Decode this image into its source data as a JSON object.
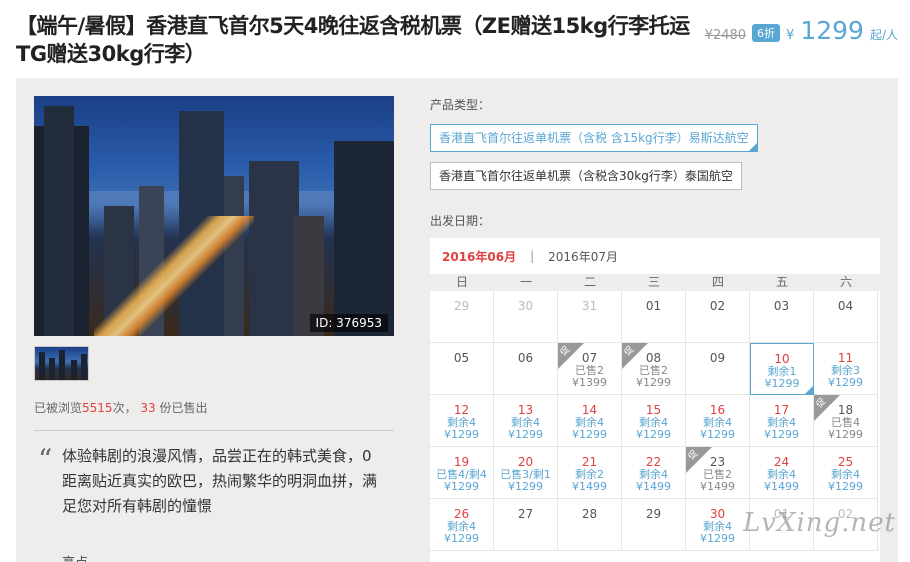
{
  "header": {
    "title": "【端午/暑假】香港直飞首尔5天4晚往返含税机票（ZE赠送15kg行李托运 TG赠送30kg行李）",
    "original_price": "¥2480",
    "discount": "6折",
    "currency": "¥",
    "price": "1299",
    "price_unit": "起/人"
  },
  "gallery": {
    "photo_id": "ID: 376953"
  },
  "stats": {
    "prefix": "已被浏览",
    "views": "5515",
    "mid": "次，",
    "sold": "33",
    "suffix": "份已售出"
  },
  "description": {
    "quote_mark": "“",
    "text": "体验韩剧的浪漫风情，品尝正在的韩式美食，0距离贴近真实的欧巴，热闹繁华的明洞血拼，满足您对所有韩剧的憧憬",
    "highlight_label": "亮点"
  },
  "product": {
    "type_label": "产品类型：",
    "types": [
      {
        "label": "香港直飞首尔往返单机票（含税 含15kg行李）易斯达航空",
        "active": true
      },
      {
        "label": "香港直飞首尔往返单机票（含税含30kg行李）泰国航空",
        "active": false
      }
    ],
    "date_label": "出发日期："
  },
  "calendar": {
    "month_active": "2016年06月",
    "separator": "|",
    "month_next": "2016年07月",
    "weekdays": [
      "日",
      "一",
      "二",
      "三",
      "四",
      "五",
      "六"
    ],
    "sale_tag": "促",
    "cells": [
      {
        "d": "29",
        "s": "other"
      },
      {
        "d": "30",
        "s": "other"
      },
      {
        "d": "31",
        "s": "other"
      },
      {
        "d": "01",
        "s": "plain"
      },
      {
        "d": "02",
        "s": "plain"
      },
      {
        "d": "03",
        "s": "plain"
      },
      {
        "d": "04",
        "s": "plain"
      },
      {
        "d": "05",
        "s": "plain"
      },
      {
        "d": "06",
        "s": "plain"
      },
      {
        "d": "07",
        "s": "sold",
        "l1": "已售2",
        "l2": "¥1399",
        "tag": true
      },
      {
        "d": "08",
        "s": "sold",
        "l1": "已售2",
        "l2": "¥1299",
        "tag": true
      },
      {
        "d": "09",
        "s": "plain"
      },
      {
        "d": "10",
        "s": "avail",
        "l1": "剩余1",
        "l2": "¥1299",
        "selected": true
      },
      {
        "d": "11",
        "s": "avail",
        "l1": "剩余3",
        "l2": "¥1299"
      },
      {
        "d": "12",
        "s": "avail",
        "l1": "剩余4",
        "l2": "¥1299"
      },
      {
        "d": "13",
        "s": "avail",
        "l1": "剩余4",
        "l2": "¥1299"
      },
      {
        "d": "14",
        "s": "avail",
        "l1": "剩余4",
        "l2": "¥1299"
      },
      {
        "d": "15",
        "s": "avail",
        "l1": "剩余4",
        "l2": "¥1299"
      },
      {
        "d": "16",
        "s": "avail",
        "l1": "剩余4",
        "l2": "¥1299"
      },
      {
        "d": "17",
        "s": "avail",
        "l1": "剩余4",
        "l2": "¥1299"
      },
      {
        "d": "18",
        "s": "sold",
        "l1": "已售4",
        "l2": "¥1299",
        "tag": true
      },
      {
        "d": "19",
        "s": "avail",
        "l1": "已售4/剩4",
        "l2": "¥1299"
      },
      {
        "d": "20",
        "s": "avail",
        "l1": "已售3/剩1",
        "l2": "¥1299"
      },
      {
        "d": "21",
        "s": "avail",
        "l1": "剩余2",
        "l2": "¥1499"
      },
      {
        "d": "22",
        "s": "avail",
        "l1": "剩余4",
        "l2": "¥1499"
      },
      {
        "d": "23",
        "s": "sold",
        "l1": "已售2",
        "l2": "¥1499",
        "tag": true
      },
      {
        "d": "24",
        "s": "avail",
        "l1": "剩余4",
        "l2": "¥1499"
      },
      {
        "d": "25",
        "s": "avail",
        "l1": "剩余4",
        "l2": "¥1299"
      },
      {
        "d": "26",
        "s": "avail",
        "l1": "剩余4",
        "l2": "¥1299"
      },
      {
        "d": "27",
        "s": "plain"
      },
      {
        "d": "28",
        "s": "plain"
      },
      {
        "d": "29",
        "s": "plain"
      },
      {
        "d": "30",
        "s": "avail",
        "l1": "剩余4",
        "l2": "¥1299"
      },
      {
        "d": "01",
        "s": "other"
      },
      {
        "d": "02",
        "s": "other"
      }
    ]
  },
  "watermark": "LvXing.net"
}
